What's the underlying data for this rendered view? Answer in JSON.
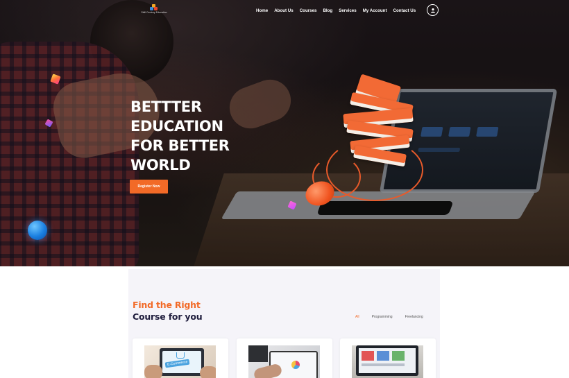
{
  "site": {
    "logo_text": "Skill Century Education"
  },
  "nav": {
    "items": [
      "Home",
      "About Us",
      "Courses",
      "Blog",
      "Services",
      "My Account",
      "Contact Us"
    ],
    "account_icon": "user-icon"
  },
  "hero": {
    "title_lines": [
      "BETTTER",
      "EDUCATION",
      "FOR BETTER",
      "WORLD"
    ],
    "cta_label": "Register Now",
    "accent_color": "#f26a27"
  },
  "courses": {
    "heading_line1": "Find the Right",
    "heading_line2": "Course for you",
    "filters": [
      "All",
      "Programming",
      "Freelancing"
    ],
    "active_filter": "All",
    "cards": [
      {
        "thumb_text": "E-Commerce"
      },
      {
        "thumb_text": ""
      },
      {
        "thumb_text": ""
      }
    ]
  }
}
